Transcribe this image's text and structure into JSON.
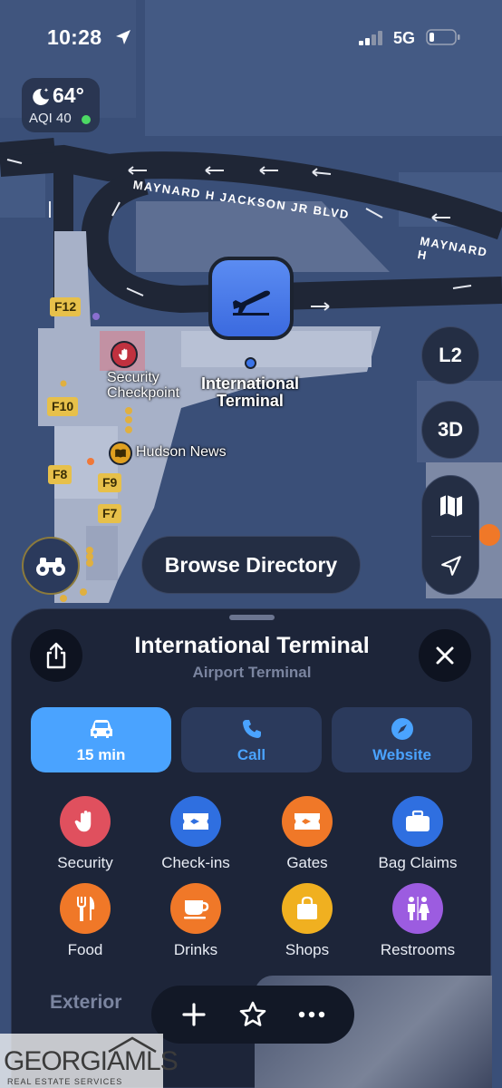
{
  "status_bar": {
    "time": "10:28",
    "network": "5G"
  },
  "weather": {
    "temperature": "64°",
    "aqi": "AQI 40",
    "aqi_color": "#4cd964"
  },
  "map": {
    "road_label_1": "MAYNARD H JACKSON JR BLVD",
    "road_label_2": "MAYNARD H",
    "gates": [
      "F12",
      "F10",
      "F8",
      "F9",
      "F7"
    ],
    "security_label": "Security Checkpoint",
    "security_line1": "Security",
    "security_line2": "Checkpoint",
    "terminal_line1": "International",
    "terminal_line2": "Terminal",
    "hudson_label": "Hudson News",
    "level_button": "L2",
    "view_button": "3D",
    "browse_label": "Browse Directory"
  },
  "sheet": {
    "title": "International Terminal",
    "subtitle": "Airport Terminal",
    "actions": [
      {
        "label": "15 min",
        "icon": "car-icon",
        "primary": true
      },
      {
        "label": "Call",
        "icon": "phone-icon",
        "primary": false
      },
      {
        "label": "Website",
        "icon": "compass-icon",
        "primary": false
      }
    ],
    "categories": [
      {
        "label": "Security",
        "icon": "hand-icon",
        "color": "#e0505e"
      },
      {
        "label": "Check-ins",
        "icon": "ticket-icon",
        "color": "#2f6fe0"
      },
      {
        "label": "Gates",
        "icon": "gate-ticket-icon",
        "color": "#f07828"
      },
      {
        "label": "Bag Claims",
        "icon": "suitcase-icon",
        "color": "#2f6fe0"
      },
      {
        "label": "Food",
        "icon": "fork-knife-icon",
        "color": "#f07828"
      },
      {
        "label": "Drinks",
        "icon": "cup-icon",
        "color": "#f07828"
      },
      {
        "label": "Shops",
        "icon": "bag-icon",
        "color": "#f0b020"
      },
      {
        "label": "Restrooms",
        "icon": "restroom-icon",
        "color": "#9c5ce0"
      }
    ],
    "exterior_label": "Exterior"
  },
  "watermark": {
    "line1": "GEORGIAMLS",
    "line2": "REAL ESTATE SERVICES"
  },
  "colors": {
    "accent": "#4aa3ff",
    "map_bg": "#3a4f78",
    "sheet_bg": "#1d2539"
  }
}
